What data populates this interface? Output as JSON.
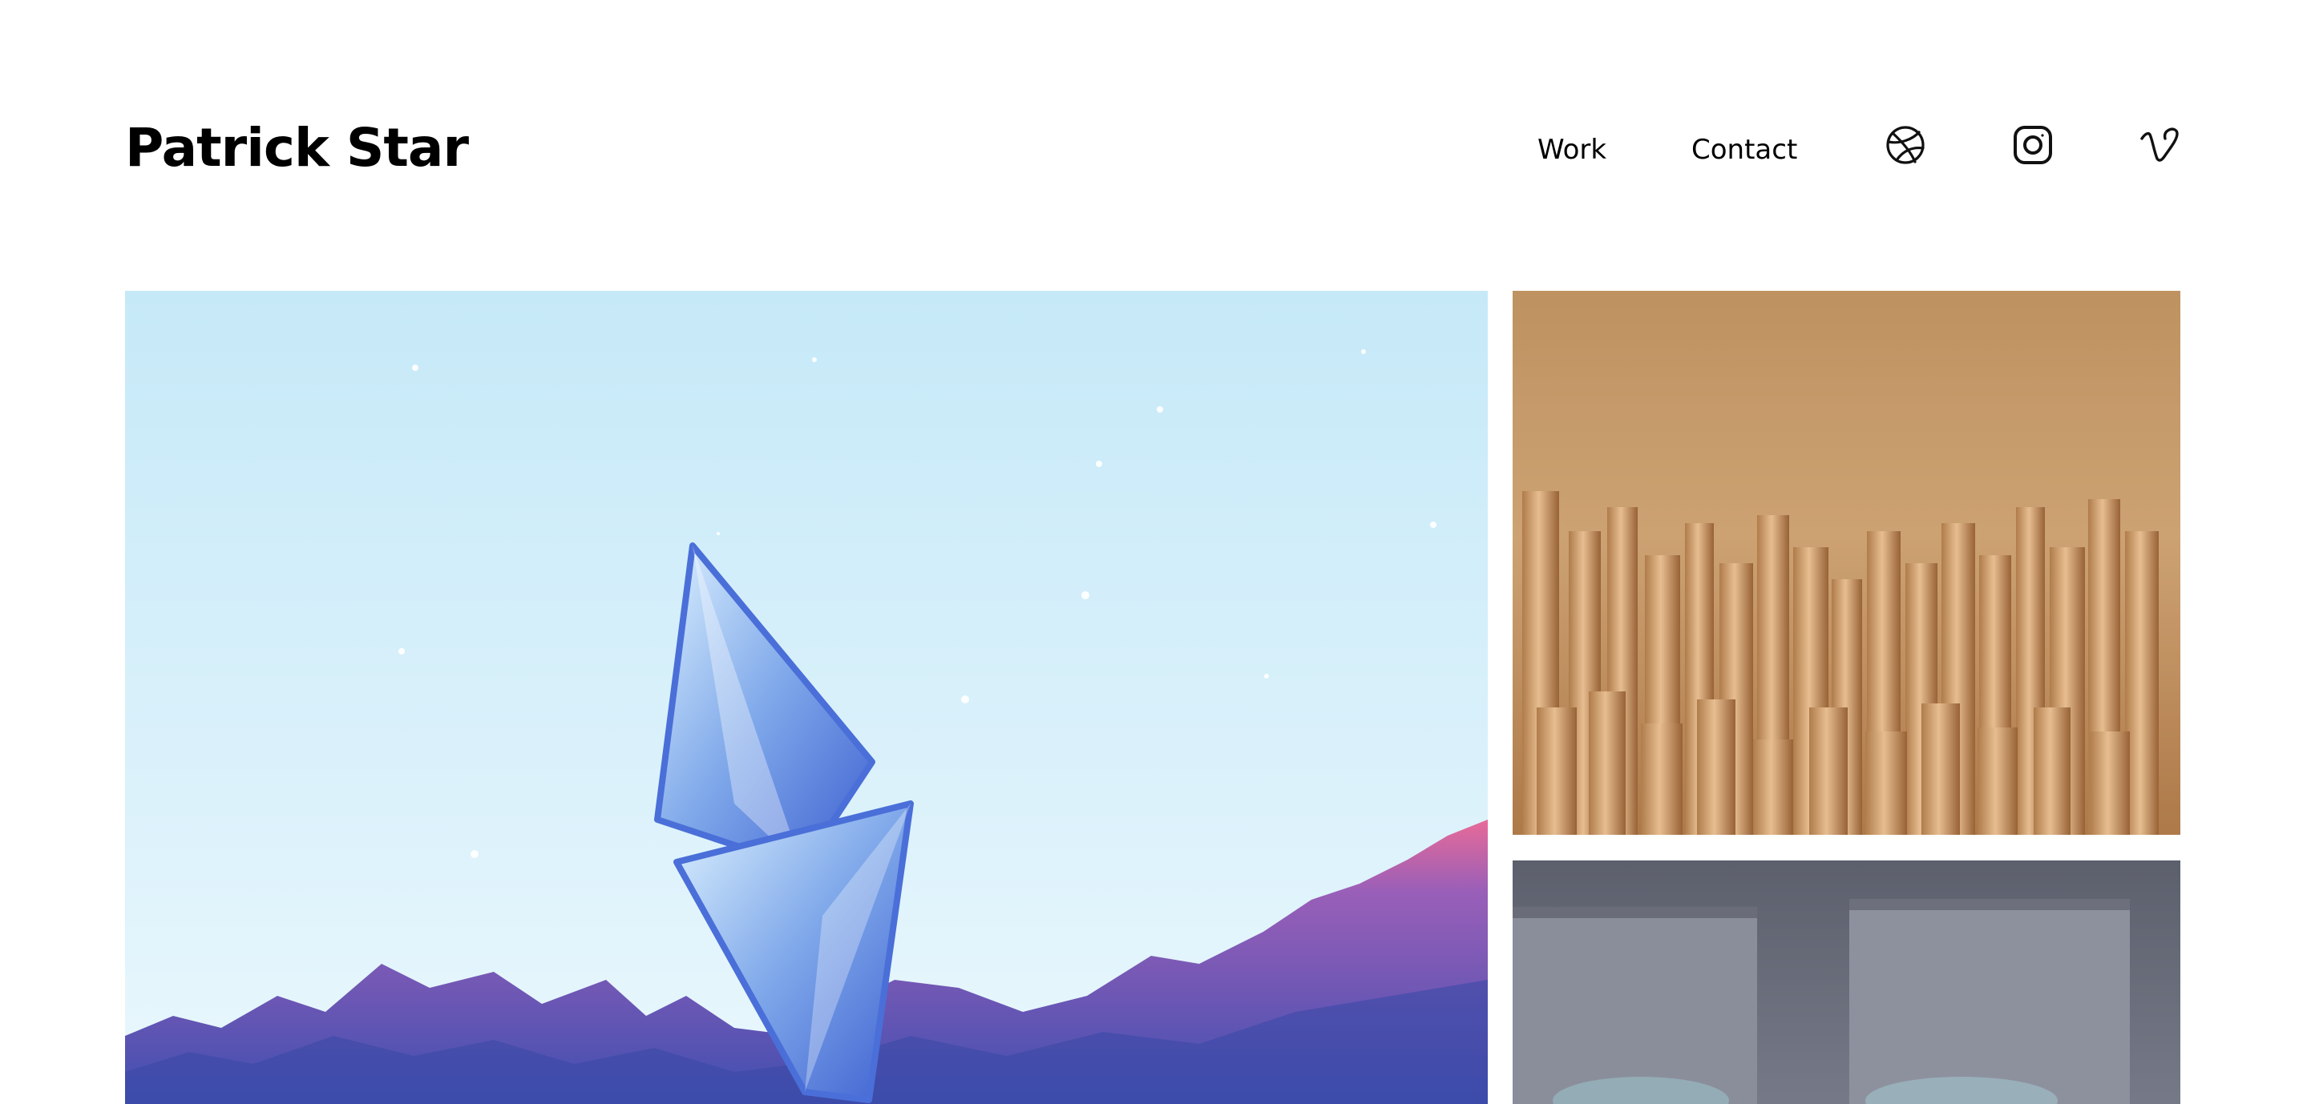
{
  "site": {
    "name": "Patrick Star"
  },
  "nav": {
    "work_label": "Work",
    "contact_label": "Contact"
  },
  "social": [
    {
      "icon": "dribbble-icon"
    },
    {
      "icon": "instagram-icon"
    },
    {
      "icon": "vimeo-icon"
    }
  ],
  "gallery": [
    {
      "subject": "crystal-shape-over-mountains"
    },
    {
      "subject": "golden-letter-columns"
    },
    {
      "subject": "grey-room-panels"
    }
  ],
  "colors": {
    "text": "#000000",
    "background": "#ffffff"
  }
}
